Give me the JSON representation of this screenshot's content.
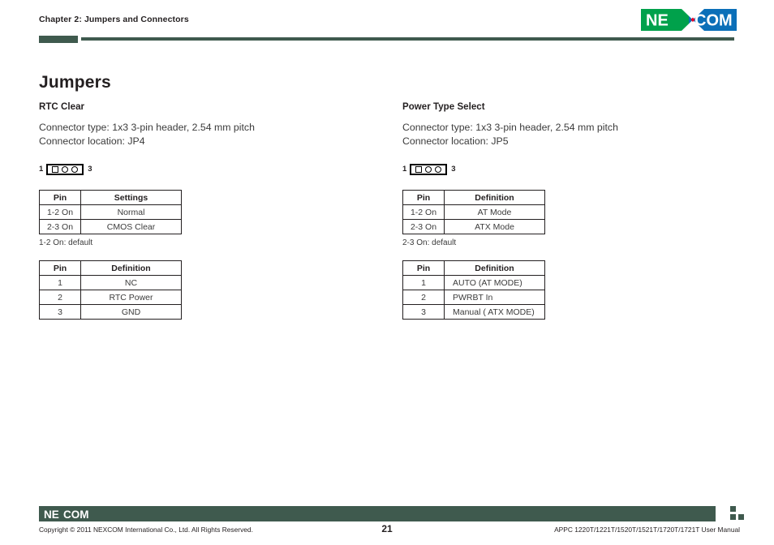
{
  "header": {
    "chapter": "Chapter 2: Jumpers and Connectors",
    "logo_alt": "NEXCOM",
    "logo_text_left": "NE",
    "logo_text_right": "COM",
    "accent_green": "#3f5a4e",
    "logo_green": "#00a14b",
    "logo_blue": "#0b6fb8",
    "logo_red": "#e4002b"
  },
  "main": {
    "title": "Jumpers",
    "sections": [
      {
        "title": "RTC Clear",
        "connector_type": "Connector type: 1x3 3-pin header, 2.54 mm pitch",
        "connector_location": "Connector location: JP4",
        "jumper": {
          "start_label": "1",
          "end_label": "3",
          "pins": [
            "square",
            "round",
            "round"
          ]
        },
        "table_settings": {
          "headers": [
            "Pin",
            "Settings"
          ],
          "rows": [
            [
              "1-2 On",
              "Normal"
            ],
            [
              "2-3 On",
              "CMOS Clear"
            ]
          ],
          "note": "1-2 On: default"
        },
        "table_definition": {
          "headers": [
            "Pin",
            "Definition"
          ],
          "rows": [
            [
              "1",
              "NC"
            ],
            [
              "2",
              "RTC Power"
            ],
            [
              "3",
              "GND"
            ]
          ]
        }
      },
      {
        "title": "Power Type Select",
        "connector_type": "Connector type: 1x3 3-pin header, 2.54 mm pitch",
        "connector_location": "Connector location: JP5",
        "jumper": {
          "start_label": "1",
          "end_label": "3",
          "pins": [
            "square",
            "round",
            "round"
          ]
        },
        "table_settings": {
          "headers": [
            "Pin",
            "Definition"
          ],
          "rows": [
            [
              "1-2 On",
              "AT Mode"
            ],
            [
              "2-3 On",
              "ATX Mode"
            ]
          ],
          "note": "2-3 On: default"
        },
        "table_definition": {
          "headers": [
            "Pin",
            "Definition"
          ],
          "rows": [
            [
              "1",
              "AUTO (AT MODE)"
            ],
            [
              "2",
              "PWRBT In"
            ],
            [
              "3",
              "Manual ( ATX MODE)"
            ]
          ]
        }
      }
    ]
  },
  "footer": {
    "logo_text": "NEXCOM",
    "copyright": "Copyright © 2011 NEXCOM International Co., Ltd. All Rights Reserved.",
    "page_number": "21",
    "manual": "APPC 1220T/1221T/1520T/1521T/1720T/1721T User Manual"
  }
}
